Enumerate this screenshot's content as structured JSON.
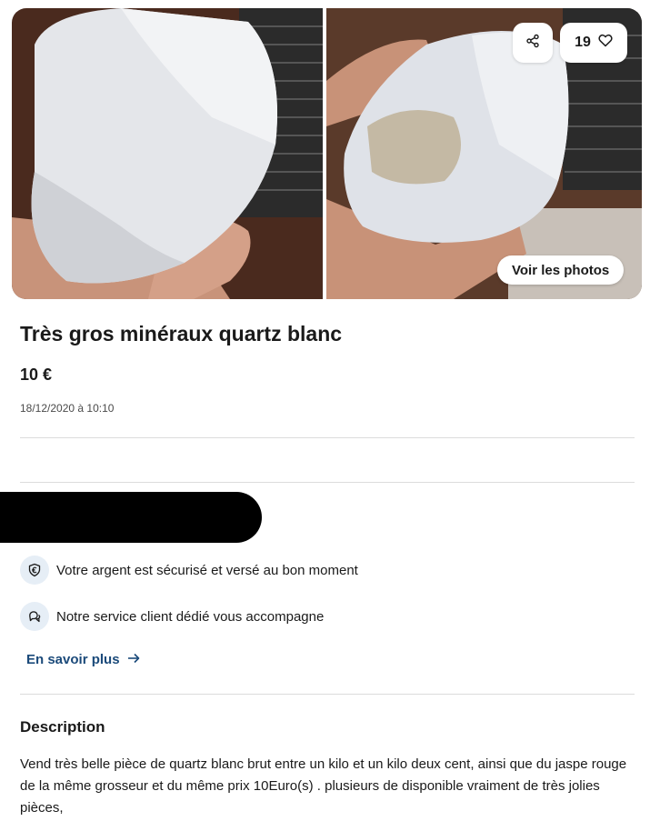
{
  "gallery": {
    "favorites_count": "19",
    "see_photos_label": "Voir les photos"
  },
  "listing": {
    "title": "Très gros minéraux quartz blanc",
    "price": "10 €",
    "date": "18/12/2020 à 10:10"
  },
  "guarantees": {
    "items": [
      {
        "icon": "shield-euro-icon",
        "text": "Votre argent est sécurisé et versé au bon moment"
      },
      {
        "icon": "chat-support-icon",
        "text": "Notre service client dédié vous accompagne"
      }
    ],
    "learn_more_label": "En savoir plus"
  },
  "description": {
    "heading": "Description",
    "body": "Vend très belle pièce de quartz blanc brut entre un kilo et un kilo deux cent, ainsi que du jaspe rouge de la même grosseur et du même prix 10Euro(s) . plusieurs de disponible vraiment de très jolies pièces,"
  },
  "colors": {
    "link": "#1b4a7a",
    "icon_bg": "#e6eef6",
    "divider": "#dcdcdc"
  }
}
